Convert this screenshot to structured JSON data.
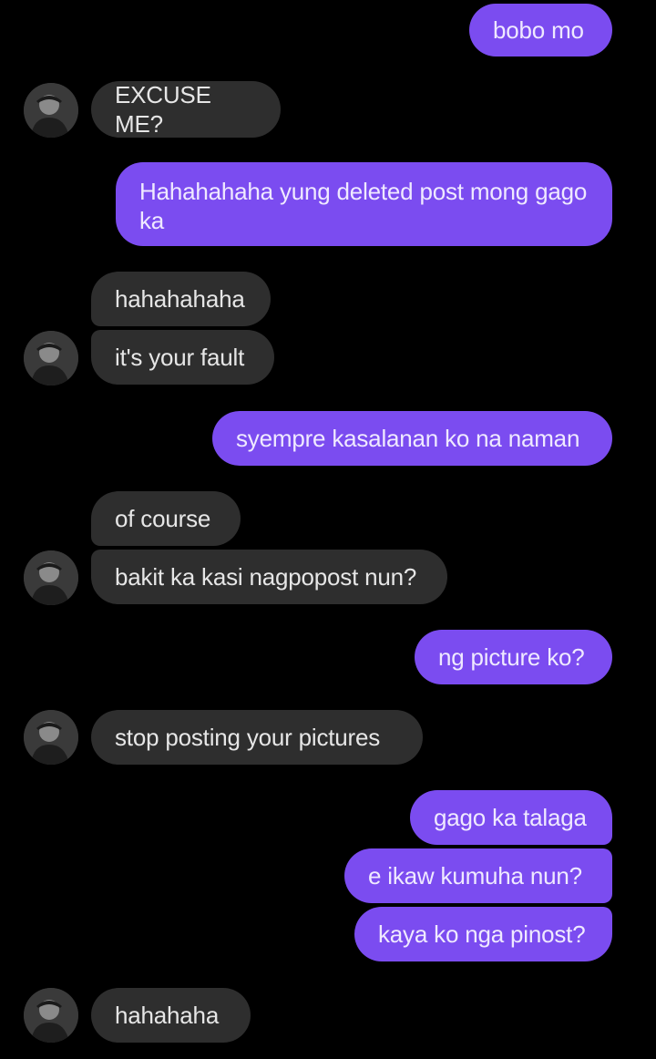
{
  "colors": {
    "background": "#000000",
    "sent_bubble": "#7b4cf0",
    "received_bubble": "#2e2e2e"
  },
  "contact": {
    "avatar_icon": "user-photo-icon"
  },
  "messages": [
    {
      "from": "me",
      "text": "bobo mo"
    },
    {
      "from": "them",
      "text": "EXCUSE ME?"
    },
    {
      "from": "me",
      "text": "Hahahahaha yung deleted post mong gago ka"
    },
    {
      "from": "them",
      "text": "hahahahaha"
    },
    {
      "from": "them",
      "text": "it's your fault"
    },
    {
      "from": "me",
      "text": "syempre kasalanan ko na naman"
    },
    {
      "from": "them",
      "text": "of course"
    },
    {
      "from": "them",
      "text": "bakit ka kasi nagpopost nun?"
    },
    {
      "from": "me",
      "text": "ng picture ko?"
    },
    {
      "from": "them",
      "text": "stop posting your pictures"
    },
    {
      "from": "me",
      "text": "gago ka talaga"
    },
    {
      "from": "me",
      "text": "e ikaw kumuha nun?"
    },
    {
      "from": "me",
      "text": "kaya ko nga pinost?"
    },
    {
      "from": "them",
      "text": "hahahaha"
    }
  ]
}
